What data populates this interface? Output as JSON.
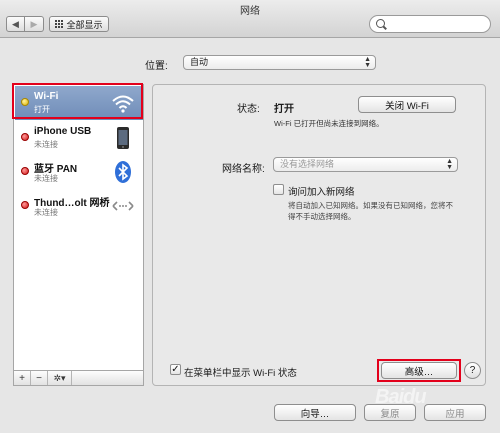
{
  "window": {
    "title": "网络"
  },
  "toolbar": {
    "back": "◀",
    "forward": "▶",
    "show_all": "全部显示",
    "search_placeholder": ""
  },
  "location": {
    "label": "位置:",
    "value": "自动"
  },
  "services": [
    {
      "name": "Wi-Fi",
      "status": "打开",
      "dot": "yellow",
      "icon": "wifi-icon",
      "selected": true
    },
    {
      "name": "iPhone USB",
      "status": "未连接",
      "dot": "red",
      "icon": "iphone-icon",
      "selected": false
    },
    {
      "name": "蓝牙 PAN",
      "status": "未连接",
      "dot": "red",
      "icon": "bluetooth-icon",
      "selected": false
    },
    {
      "name": "Thund…olt 网桥",
      "status": "未连接",
      "dot": "red",
      "icon": "thunderbolt-bridge-icon",
      "selected": false
    }
  ],
  "sidebar_controls": {
    "add": "+",
    "remove": "−",
    "gear": "✲▾"
  },
  "detail": {
    "status_label": "状态:",
    "status_value": "打开",
    "wifi_off_button": "关闭 Wi-Fi",
    "status_description": "Wi-Fi 已打开但尚未连接到网络。",
    "network_name_label": "网络名称:",
    "network_name_placeholder": "没有选择网络",
    "ask_join_label": "询问加入新网络",
    "ask_join_checked": false,
    "ask_join_description": "将自动加入已知网络。如果没有已知网络，您将不得不手动选择网络。",
    "show_wifi_label": "在菜单栏中显示 Wi-Fi 状态",
    "show_wifi_checked": true,
    "advanced_button": "高级…",
    "help": "?"
  },
  "footer": {
    "assist_button": "向导…",
    "revert_button": "复原",
    "apply_button": "应用"
  },
  "watermark": "Baidu",
  "colors": {
    "selection": "#7b97c2",
    "highlight_box": "#e3001b",
    "status_on": "#e0b400",
    "status_off": "#d21a1a"
  }
}
